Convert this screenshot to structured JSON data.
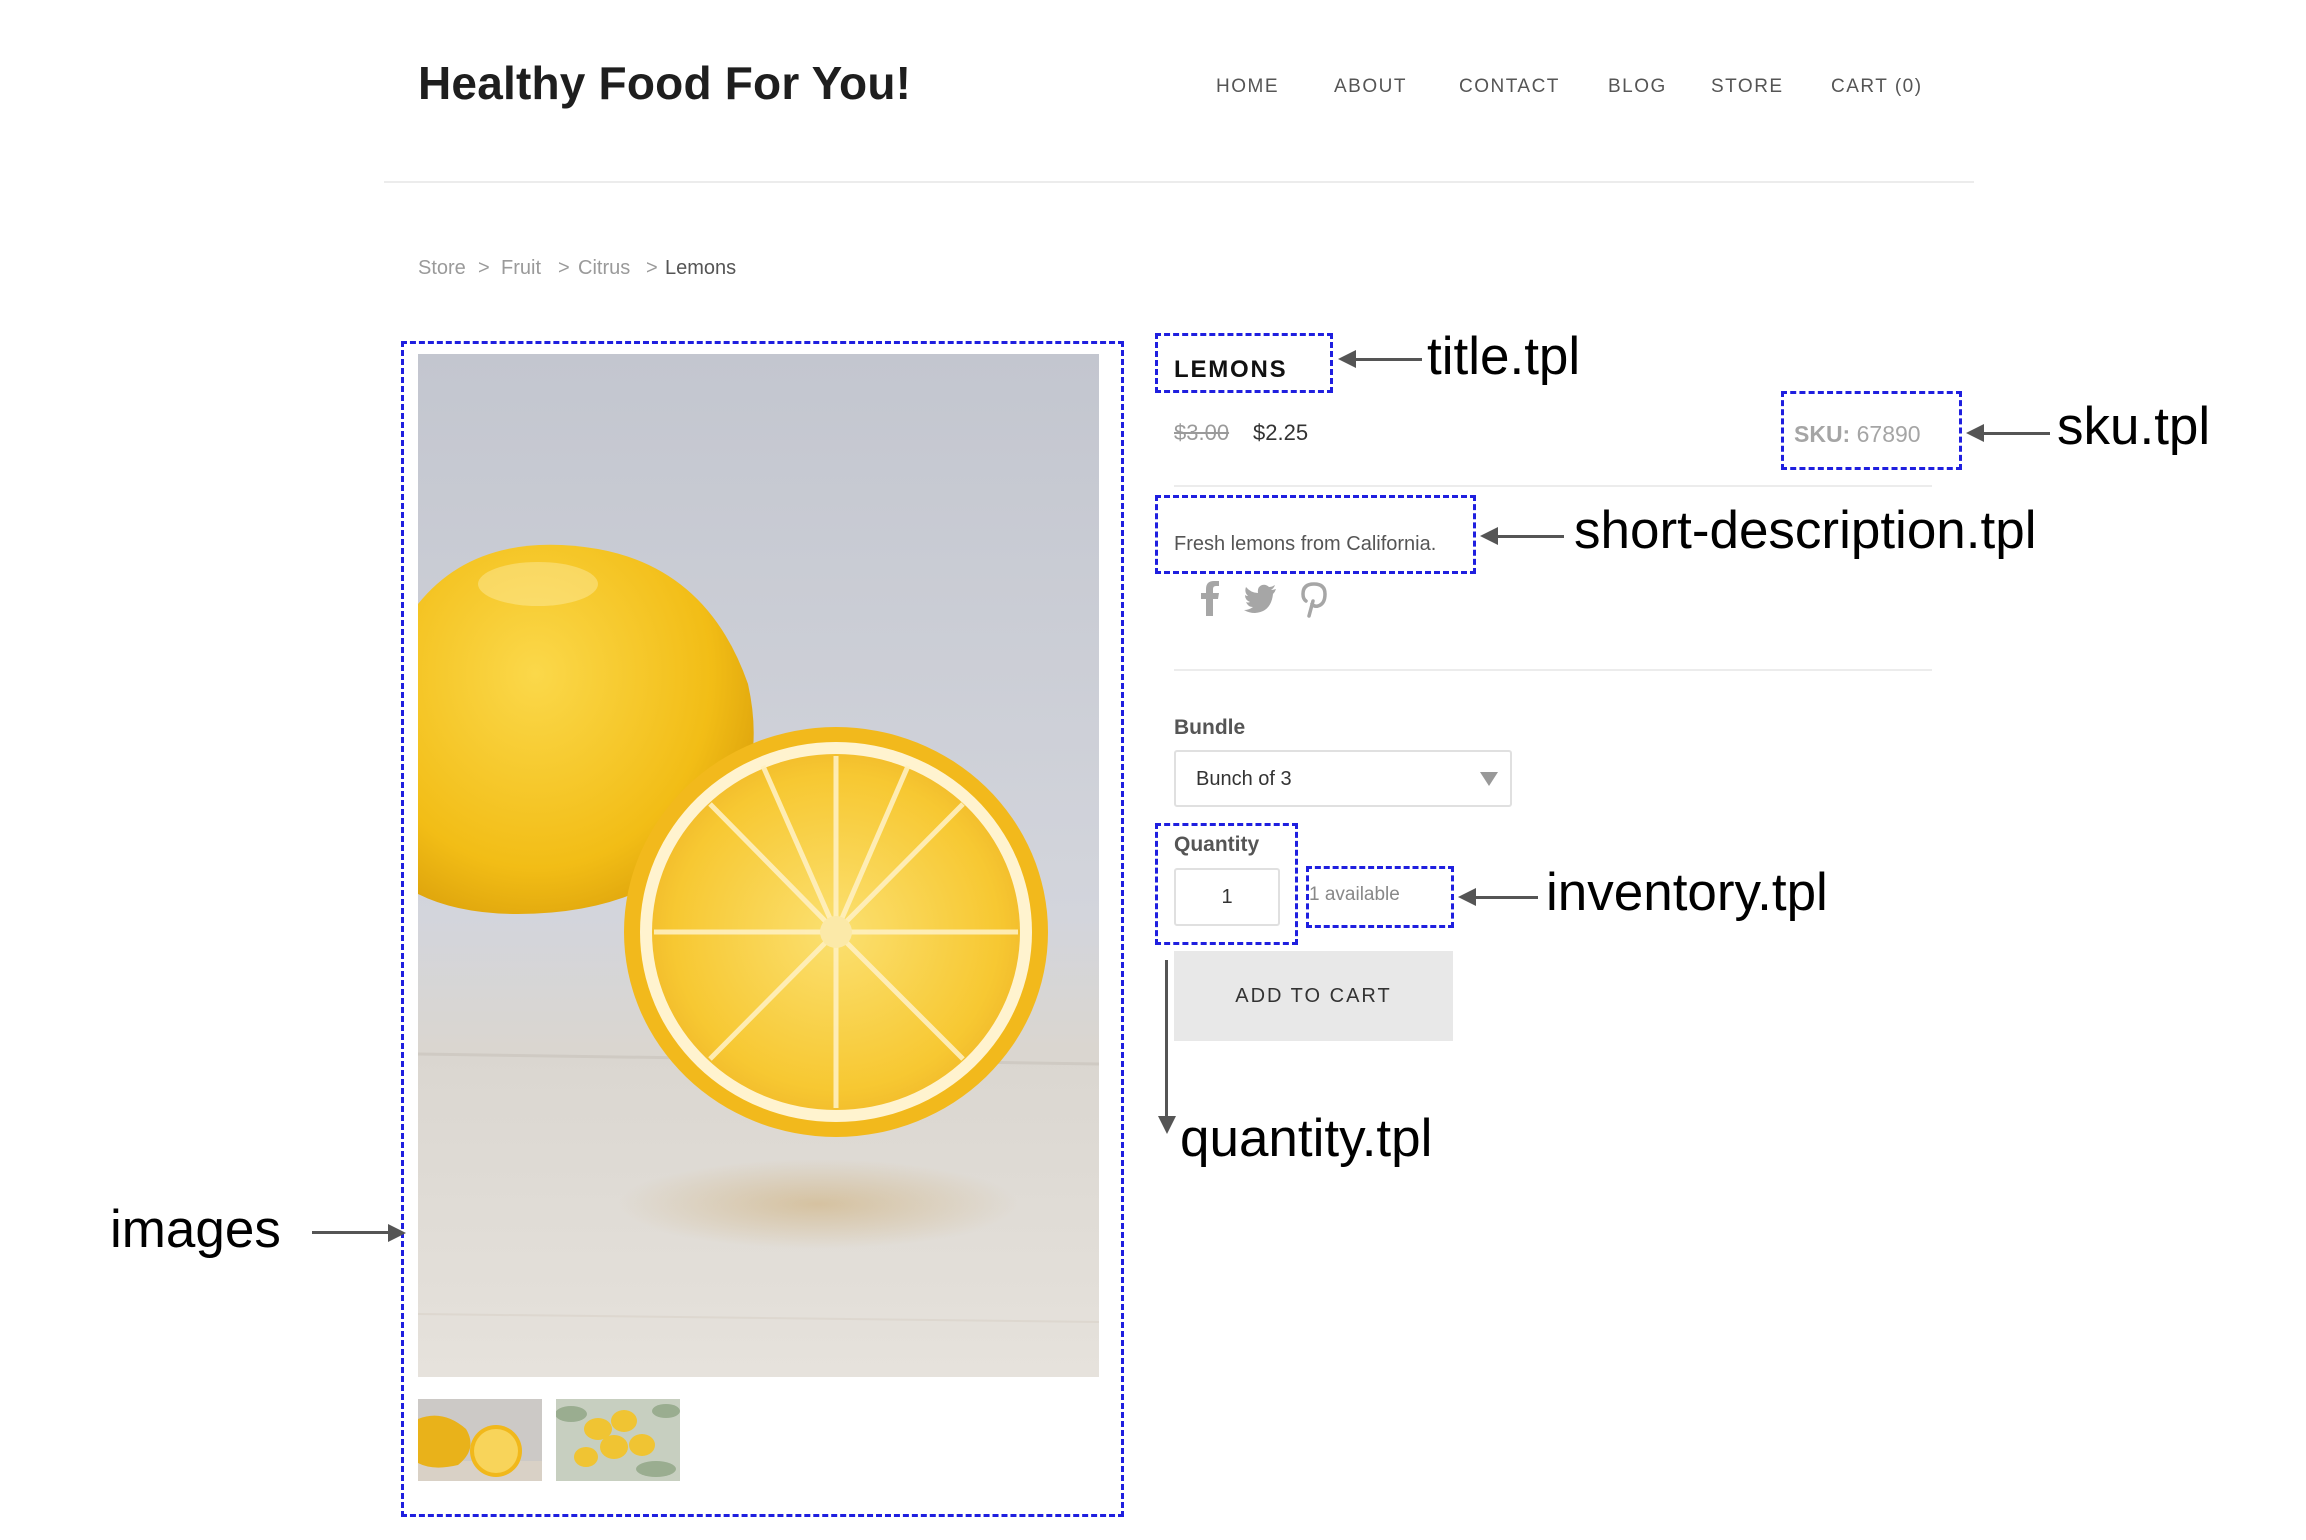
{
  "header": {
    "site_title": "Healthy Food For You!",
    "nav": [
      "HOME",
      "ABOUT",
      "CONTACT",
      "BLOG",
      "STORE",
      "CART (0)"
    ]
  },
  "breadcrumb": {
    "items": [
      "Store",
      "Fruit",
      "Citrus",
      "Lemons"
    ],
    "separator": ">"
  },
  "product": {
    "title": "LEMONS",
    "old_price": "$3.00",
    "price": "$2.25",
    "sku_label": "SKU:",
    "sku_value": "67890",
    "short_description": "Fresh lemons from California.",
    "social_icons": [
      "facebook-icon",
      "twitter-icon",
      "pinterest-icon"
    ],
    "bundle_label": "Bundle",
    "bundle_selected": "Bunch of 3",
    "quantity_label": "Quantity",
    "quantity_value": "1",
    "inventory": "1 available",
    "add_to_cart": "ADD TO CART",
    "thumbnail_count": 2
  },
  "annotations": {
    "title": "title.tpl",
    "sku": "sku.tpl",
    "short_description": "short-description.tpl",
    "inventory": "inventory.tpl",
    "quantity": "quantity.tpl",
    "images": "images"
  },
  "colors": {
    "annotation_box": "#1f1fdf",
    "button_bg": "#e8e8e8",
    "lemon": "#f5c21a"
  }
}
